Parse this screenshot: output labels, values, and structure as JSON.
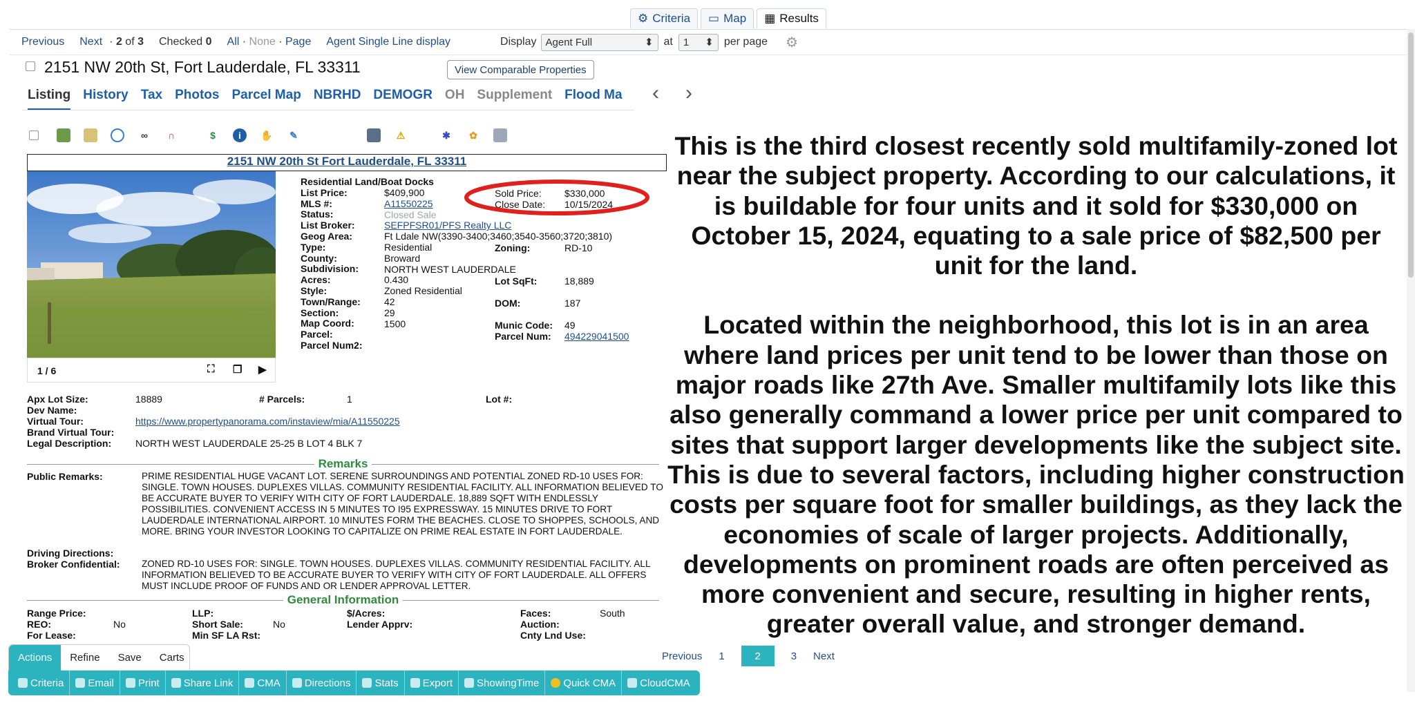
{
  "top_tabs": [
    {
      "label": "Criteria",
      "icon": "sliders-icon"
    },
    {
      "label": "Map",
      "icon": "map-icon"
    },
    {
      "label": "Results",
      "icon": "table-icon"
    }
  ],
  "toolbar": {
    "previous": "Previous",
    "next": "Next",
    "count_prefix": "· ",
    "count_current": "2",
    "count_of": "of",
    "count_total": "3",
    "checked_label": "Checked",
    "checked_count": "0",
    "sel_all": "All",
    "sel_none": "None",
    "sel_page": "Page",
    "single_line": "Agent Single Line display",
    "display_label": "Display",
    "display_value": "Agent Full",
    "at_label": "at",
    "per_page_value": "1",
    "per_page_label": "per page"
  },
  "listing": {
    "address": "2151 NW 20th St, Fort Lauderdale, FL 33311",
    "compare_button": "View Comparable Properties",
    "tabs": [
      "Listing",
      "History",
      "Tax",
      "Photos",
      "Parcel Map",
      "NBRHD",
      "DEMOGR",
      "OH",
      "Supplement",
      "Flood Ma"
    ],
    "title_link": "2151 NW 20th St Fort Lauderdale, FL 33311",
    "photo_counter": "1 / 6",
    "heading": "Residential Land/Boat Docks",
    "labels": {
      "list_price": "List Price:",
      "mls": "MLS #:",
      "status": "Status:",
      "list_broker": "List Broker:",
      "geog_area": "Geog Area:",
      "type": "Type:",
      "county": "County:",
      "subdivision": "Subdivision:",
      "acres": "Acres:",
      "style": "Style:",
      "town_range": "Town/Range:",
      "section": "Section:",
      "map_coord": "Map Coord:",
      "parcel": "Parcel:",
      "parcel_num2": "Parcel Num2:"
    },
    "values": {
      "list_price": "$409,900",
      "mls": "A11550225",
      "status": "Closed Sale",
      "list_broker": "SEFPFSR01/PFS Realty LLC",
      "geog_area": "Ft Ldale NW(3390-3400;3460;3540-3560;3720;3810)",
      "type": "Residential",
      "county": "Broward",
      "subdivision": "NORTH WEST LAUDERDALE",
      "acres": "0.430",
      "style": "Zoned Residential",
      "town_range": "42",
      "section": "29",
      "map_coord": "",
      "parcel": "1500",
      "parcel_num2": ""
    },
    "right": {
      "sold_price_label": "Sold Price:",
      "sold_price": "$330,000",
      "close_date_label": "Close Date:",
      "close_date": "10/15/2024",
      "zoning_label": "Zoning:",
      "zoning": "RD-10",
      "lot_sqft_label": "Lot SqFt:",
      "lot_sqft": "18,889",
      "dom_label": "DOM:",
      "dom": "187",
      "munic_label": "Munic Code:",
      "munic": "49",
      "parcel_num_label": "Parcel Num:",
      "parcel_num": "494229041500"
    },
    "lower": {
      "apx_label": "Apx Lot Size:",
      "apx": "18889",
      "parcels_label": "# Parcels:",
      "parcels": "1",
      "lot_label": "Lot #:",
      "dev_label": "Dev Name:",
      "vt_label": "Virtual Tour:",
      "vt": "https://www.propertypanorama.com/instaview/mia/A11550225",
      "bvt_label": "Brand Virtual Tour:",
      "legal_label": "Legal Description:",
      "legal": "NORTH WEST LAUDERDALE 25-25 B LOT 4 BLK 7"
    },
    "remarks_heading": "Remarks",
    "public_label": "Public Remarks:",
    "public": "PRIME RESIDENTIAL HUGE VACANT LOT. SERENE SURROUNDINGS AND POTENTIAL ZONED RD-10 USES FOR: SINGLE. TOWN HOUSES. DUPLEXES VILLAS. COMMUNITY RESIDENTIAL FACILITY. ALL INFORMATION BELIEVED TO BE ACCURATE BUYER TO VERIFY WITH CITY OF FORT LAUDERDALE. 18,889 SQFT WITH ENDLESSLY POSSIBILITIES. CONVENIENT ACCESS IN 5 MINUTES TO I95 EXPRESSWAY. 15 MINUTES DRIVE TO FORT LAUDERDALE INTERNATIONAL AIRPORT. 10 MINUTES FORM THE BEACHES. CLOSE TO SHOPPES, SCHOOLS, AND MORE. BRING YOUR INVESTOR LOOKING TO CAPITALIZE ON PRIME REAL ESTATE IN FORT LAUDERDALE.",
    "driving_label": "Driving Directions:",
    "broker_label": "Broker Confidential:",
    "broker": "ZONED RD-10 USES FOR: SINGLE. TOWN HOUSES. DUPLEXES VILLAS. COMMUNITY RESIDENTIAL FACILITY. ALL INFORMATION BELIEVED TO BE ACCURATE BUYER TO VERIFY WITH CITY OF FORT LAUDERDALE. ALL OFFERS MUST INCLUDE PROOF OF FUNDS AND OR LENDER APPROVAL LETTER.",
    "general_heading": "General Information",
    "gen": {
      "range": "Range Price:",
      "llp": "LLP:",
      "per_acre": "$/Acres:",
      "faces": "Faces:",
      "faces_val": "South",
      "reo": "REO:",
      "reo_val": "No",
      "short": "Short Sale:",
      "short_val": "No",
      "lender": "Lender Apprv:",
      "auction": "Auction:",
      "lease": "For Lease:",
      "minsf": "Min SF LA Rst:",
      "cnty": "Cnty Lnd Use:"
    }
  },
  "essay": {
    "p1": "This is the third closest recently sold multifamily-zoned lot near the subject property. According to our calculations, it is buildable for four units and it sold for $330,000 on October 15, 2024, equating to a sale price of $82,500 per unit for the land.",
    "p2": "Located within the neighborhood, this lot is in an area where land prices per unit tend to be lower than those on major roads like 27th Ave. Smaller multifamily lots like this also generally command a lower price per unit compared to sites that support larger developments like the subject site. This is due to several factors, including higher construction costs per square foot for smaller buildings, as they lack the economies of scale of larger projects. Additionally, developments on prominent roads are often perceived as more convenient and secure, resulting in higher rents, greater overall value, and stronger demand."
  },
  "bottom_tabs": [
    "Actions",
    "Refine",
    "Save",
    "Carts"
  ],
  "actions": [
    "Criteria",
    "Email",
    "Print",
    "Share Link",
    "CMA",
    "Directions",
    "Stats",
    "Export",
    "ShowingTime",
    "Quick CMA",
    "CloudCMA"
  ],
  "pager": {
    "previous": "Previous",
    "pages": [
      "1",
      "2",
      "3"
    ],
    "current": "2",
    "next": "Next"
  },
  "colors": {
    "accent": "#2bb3c0",
    "link": "#1f4e8c",
    "highlight": "#e0201c",
    "section": "#2e8b3e"
  }
}
